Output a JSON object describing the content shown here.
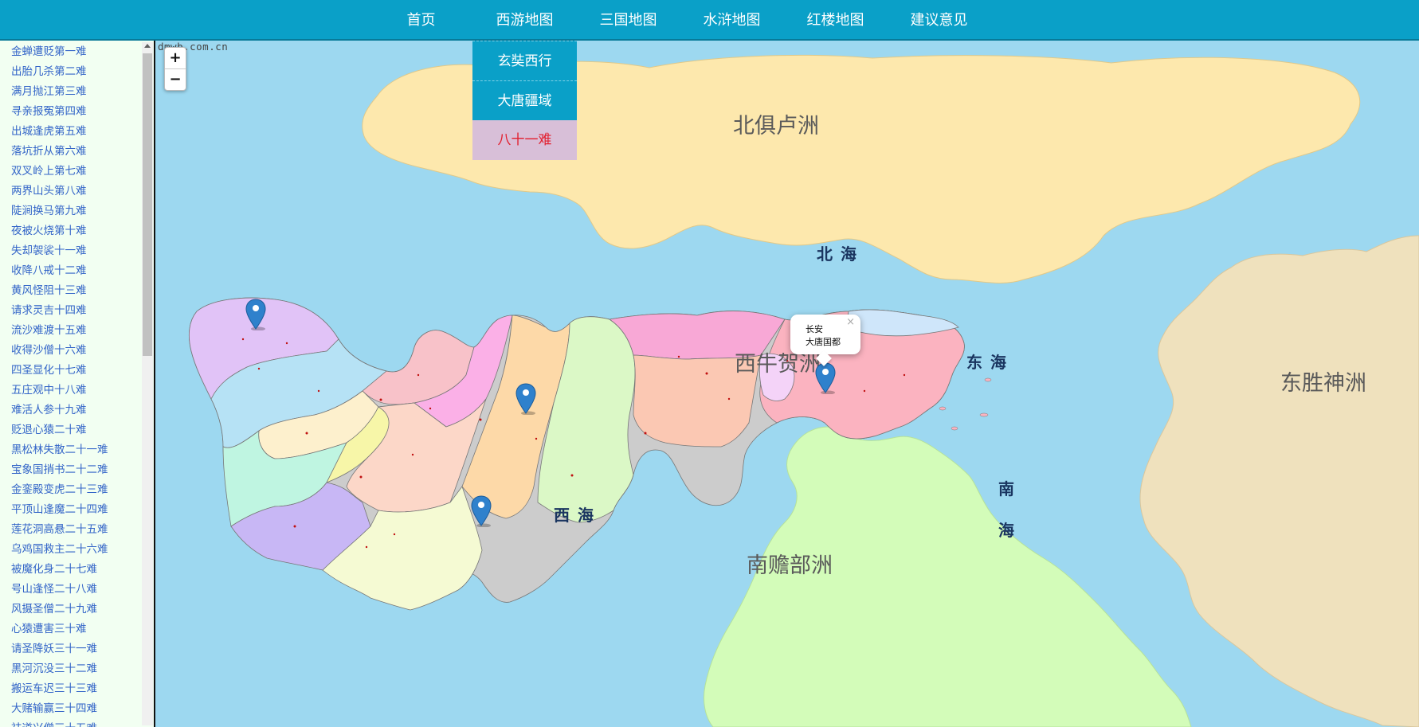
{
  "nav": {
    "items": [
      "首页",
      "西游地图",
      "三国地图",
      "水浒地图",
      "红楼地图",
      "建议意见"
    ],
    "dropdown": [
      "玄奘西行",
      "大唐疆域",
      "八十一难"
    ]
  },
  "sidebar": {
    "items": [
      "金蝉遭贬第一难",
      "出胎几杀第二难",
      "满月抛江第三难",
      "寻亲报冤第四难",
      "出城逢虎第五难",
      "落坑折从第六难",
      "双叉岭上第七难",
      "两界山头第八难",
      "陡涧换马第九难",
      "夜被火烧第十难",
      "失却袈裟十一难",
      "收降八戒十二难",
      "黄风怪阻十三难",
      "请求灵吉十四难",
      "流沙难渡十五难",
      "收得沙僧十六难",
      "四圣显化十七难",
      "五庄观中十八难",
      "难活人参十九难",
      "贬退心猿二十难",
      "黑松林失散二十一难",
      "宝象国捎书二十二难",
      "金銮殿变虎二十三难",
      "平顶山逢魔二十四难",
      "莲花洞高悬二十五难",
      "乌鸡国救主二十六难",
      "被魔化身二十七难",
      "号山逢怪二十八难",
      "风摄圣僧二十九难",
      "心猿遭害三十难",
      "请圣降妖三十一难",
      "黑河沉没三十二难",
      "搬运车迟三十三难",
      "大赌输赢三十四难",
      "祛道兴僧三十五难"
    ]
  },
  "map": {
    "watermark": "dmwb.com.cn",
    "zoom_in": "+",
    "zoom_out": "−",
    "regions": {
      "north": "北俱卢洲",
      "west": "西牛贺洲",
      "east": "东胜神洲",
      "south": "南赡部洲"
    },
    "seas": {
      "north": "北海",
      "east": "东海",
      "west": "西海",
      "south_top": "南",
      "south_bottom": "海"
    },
    "popup": {
      "title": "长安",
      "subtitle": "大唐国都",
      "close": "×"
    },
    "colors": {
      "water": "#9dd8f0",
      "north_land": "#fde8ad",
      "east_land": "#efe1bd",
      "south_land": "#d3fcb9",
      "marker": "#2f81cc",
      "nav": "#0aa0c8",
      "active_item": "#e21f2e"
    },
    "icons": [
      "map-marker-icon",
      "close-icon"
    ]
  }
}
